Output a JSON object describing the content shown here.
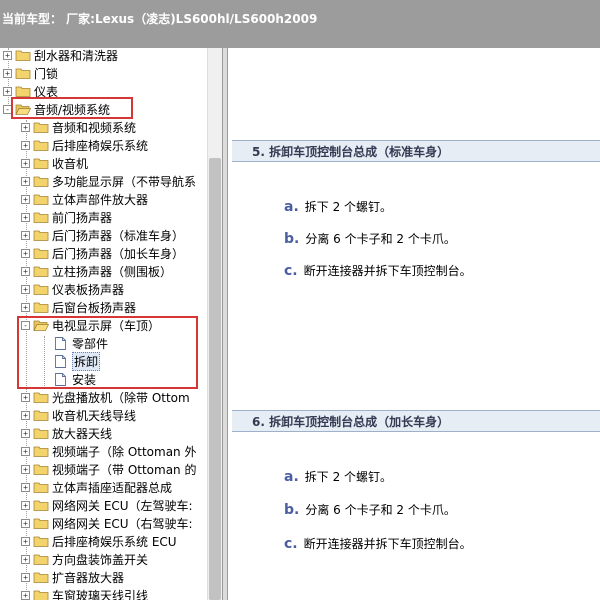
{
  "header": {
    "title": "当前车型：  厂家:Lexus（凌志)LS600hl/LS600h2009"
  },
  "tree": {
    "items": [
      {
        "label": "刮水器和清洗器",
        "icon": "folder-icon",
        "expander": "+"
      },
      {
        "label": "门锁",
        "icon": "folder-icon",
        "expander": "+"
      },
      {
        "label": "仪表",
        "icon": "folder-icon",
        "expander": "+"
      },
      {
        "label": "音频/视频系统",
        "icon": "folder-open-icon",
        "expander": "-"
      },
      {
        "label": "音频和视频系统",
        "icon": "folder-icon",
        "expander": "+"
      },
      {
        "label": "后排座椅娱乐系统",
        "icon": "folder-icon",
        "expander": "+"
      },
      {
        "label": "收音机",
        "icon": "folder-icon",
        "expander": "+"
      },
      {
        "label": "多功能显示屏（不带导航系",
        "icon": "folder-icon",
        "expander": "+"
      },
      {
        "label": "立体声部件放大器",
        "icon": "folder-icon",
        "expander": "+"
      },
      {
        "label": "前门扬声器",
        "icon": "folder-icon",
        "expander": "+"
      },
      {
        "label": "后门扬声器（标准车身）",
        "icon": "folder-icon",
        "expander": "+"
      },
      {
        "label": "后门扬声器（加长车身）",
        "icon": "folder-icon",
        "expander": "+"
      },
      {
        "label": "立柱扬声器（侧围板）",
        "icon": "folder-icon",
        "expander": "+"
      },
      {
        "label": "仪表板扬声器",
        "icon": "folder-icon",
        "expander": "+"
      },
      {
        "label": "后窗台板扬声器",
        "icon": "folder-icon",
        "expander": "+"
      },
      {
        "label": "电视显示屏（车顶）",
        "icon": "folder-open-icon",
        "expander": "-"
      },
      {
        "label": "零部件",
        "icon": "document-icon",
        "expander": ""
      },
      {
        "label": "拆卸",
        "icon": "document-icon",
        "expander": "",
        "selected": true
      },
      {
        "label": "安装",
        "icon": "document-icon",
        "expander": ""
      },
      {
        "label": "光盘播放机（除带 Ottom",
        "icon": "folder-icon",
        "expander": "+"
      },
      {
        "label": "收音机天线导线",
        "icon": "folder-icon",
        "expander": "+"
      },
      {
        "label": "放大器天线",
        "icon": "folder-icon",
        "expander": "+"
      },
      {
        "label": "视频端子（除 Ottoman 外",
        "icon": "folder-icon",
        "expander": "+"
      },
      {
        "label": "视频端子（带 Ottoman 的",
        "icon": "folder-icon",
        "expander": "+"
      },
      {
        "label": "立体声插座适配器总成",
        "icon": "folder-icon",
        "expander": "+"
      },
      {
        "label": "网络网关 ECU（左驾驶车:",
        "icon": "folder-icon",
        "expander": "+"
      },
      {
        "label": "网络网关 ECU（右驾驶车:",
        "icon": "folder-icon",
        "expander": "+"
      },
      {
        "label": "后排座椅娱乐系统 ECU",
        "icon": "folder-icon",
        "expander": "+"
      },
      {
        "label": "方向盘装饰盖开关",
        "icon": "folder-icon",
        "expander": "+"
      },
      {
        "label": "扩音器放大器",
        "icon": "folder-icon",
        "expander": "+"
      },
      {
        "label": "车窗玻璃天线引线",
        "icon": "folder-icon",
        "expander": "+"
      }
    ]
  },
  "content": {
    "sections": [
      {
        "title": "5. 拆卸车顶控制台总成（标准车身）",
        "steps": [
          {
            "letter": "a.",
            "text": "拆下 2 个螺钉。"
          },
          {
            "letter": "b.",
            "text": "分离 6 个卡子和 2 个卡爪。"
          },
          {
            "letter": "c.",
            "text": "断开连接器并拆下车顶控制台。"
          }
        ]
      },
      {
        "title": "6. 拆卸车顶控制台总成（加长车身）",
        "steps": [
          {
            "letter": "a.",
            "text": "拆下 2 个螺钉。"
          },
          {
            "letter": "b.",
            "text": "分离 6 个卡子和 2 个卡爪。"
          },
          {
            "letter": "c.",
            "text": "断开连接器并拆下车顶控制台。"
          }
        ]
      }
    ]
  },
  "colors": {
    "header_bg": "#9c9c9c",
    "highlight_box": "#d63636",
    "section_bg": "#e7edf5",
    "step_letter": "#4b5ea0",
    "folder_yellow": "#f3d36b"
  }
}
